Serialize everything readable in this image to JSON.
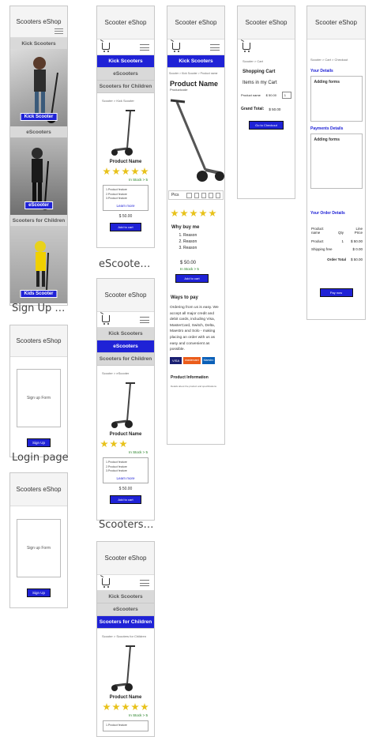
{
  "brand": "Scooters eShop",
  "brand_alt": "Scooter eShop",
  "nav": {
    "kick": "Kick Scooters",
    "e": "eScooters",
    "children": "Scooters for Children"
  },
  "captions": {
    "escooter_page": "eScooter ...",
    "signup_page": "Sign Up p...",
    "login_page": "Login page",
    "scooters_for": "Scooters f..."
  },
  "home": {
    "kick_label": "Kick Scooter",
    "e_label": "eScooter",
    "kids_label": "Kids Scooter"
  },
  "crumbs": {
    "kick": "Scooter > Kick Scooter",
    "e": "Scooter > eScooter",
    "children": "Scooter > Scooters for Children",
    "product": "Scooter > Kick Scooter > Product name",
    "cart": "Scooter > Cart",
    "checkout": "Scooter > Cart > Checkout"
  },
  "listing": {
    "product_name": "Product Name",
    "stock": "In Stock > 5",
    "features": [
      "1.Product feature",
      "2.Product feature",
      "3.Product feature"
    ],
    "learn_more": "Learn more",
    "price": "$ 50.00",
    "add_to_cart": "Add to cart"
  },
  "product": {
    "title": "Product Name",
    "code": "Productcode",
    "pics_label": "Pics",
    "why_title": "Why buy me",
    "reasons": [
      "Reason",
      "Reason",
      "Reason"
    ],
    "price": "$ 50.00",
    "stock": "In Stock > 5",
    "add_to_cart": "Add to cart",
    "ways_title": "Ways to pay",
    "ways_text": "Ordering from us is easy. We accept all major credit and debit cards, including Visa, MasterCard, Switch, Delta, Maestro and Solo - making placing an order with us as easy and convenient as possible.",
    "cards": [
      "VISA",
      "mastercard",
      "Maestro"
    ],
    "info_title": "Product Information",
    "info_text": "Details about the product and specifications"
  },
  "cart": {
    "title": "Shopping Cart",
    "items_label": "Items in my Cart",
    "product_name": "Product name",
    "price": "$ 50.00",
    "qty": "1",
    "grand_total_label": "Grand Total:",
    "grand_total": "$ 50.00",
    "checkout_btn": "Go to Checkout"
  },
  "checkout": {
    "your_details": "Your Details",
    "adding_forms_1": "Adding forms",
    "payments_details": "Payments Details",
    "adding_forms_2": "Adding forms",
    "order_details": "Your Order Details",
    "col_product": "Product name",
    "col_qty": "Qty",
    "col_price": "Line Price",
    "row_product": "Product",
    "row_qty": "1",
    "row_price": "$ 50.00",
    "shipping_label": "Shipping free",
    "shipping_price": "$ 0.00",
    "order_total_label": "Order Total",
    "order_total": "$ 50.00",
    "pay_btn": "Pay now"
  },
  "signup": {
    "form_label": "Sign up Form",
    "button": "Sign Up"
  },
  "login": {
    "form_label": "Sign up Form",
    "button": "Sign Up"
  },
  "colors": {
    "accent": "#1f22d6",
    "star": "#e8c21b",
    "nav_bg": "#d9d9d9"
  }
}
